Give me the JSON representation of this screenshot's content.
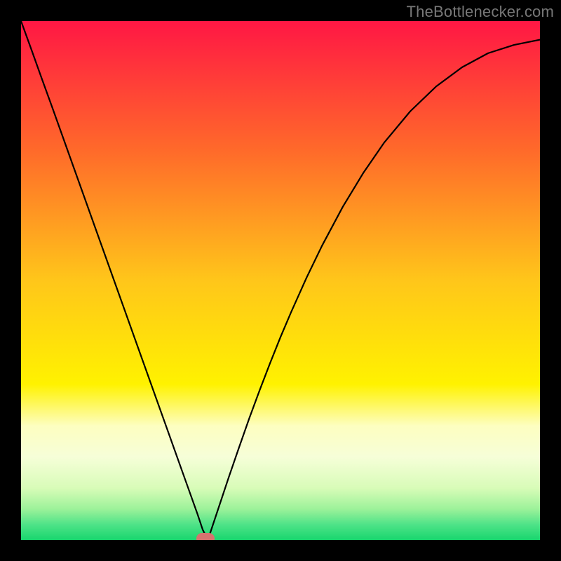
{
  "attribution": "TheBottlenecker.com",
  "chart_data": {
    "type": "line",
    "title": "",
    "xlabel": "",
    "ylabel": "",
    "xlim": [
      0,
      1
    ],
    "ylim": [
      0,
      1
    ],
    "x": [
      0.0,
      0.02,
      0.04,
      0.06,
      0.08,
      0.1,
      0.12,
      0.14,
      0.16,
      0.18,
      0.2,
      0.22,
      0.24,
      0.26,
      0.28,
      0.3,
      0.32,
      0.34,
      0.35,
      0.36,
      0.38,
      0.4,
      0.42,
      0.44,
      0.46,
      0.48,
      0.5,
      0.52,
      0.55,
      0.58,
      0.62,
      0.66,
      0.7,
      0.75,
      0.8,
      0.85,
      0.9,
      0.95,
      1.0
    ],
    "values": [
      1.0,
      0.945,
      0.889,
      0.834,
      0.778,
      0.722,
      0.666,
      0.61,
      0.554,
      0.498,
      0.442,
      0.386,
      0.33,
      0.274,
      0.218,
      0.162,
      0.106,
      0.05,
      0.02,
      0.0,
      0.06,
      0.12,
      0.178,
      0.235,
      0.289,
      0.341,
      0.391,
      0.438,
      0.505,
      0.567,
      0.642,
      0.708,
      0.766,
      0.826,
      0.874,
      0.911,
      0.938,
      0.954,
      0.964
    ],
    "minimum_marker": {
      "x": 0.355,
      "y": 0.0,
      "color": "#d6736f"
    },
    "background_gradient_stops": [
      {
        "pos": 0.0,
        "color": "#ff1744"
      },
      {
        "pos": 0.25,
        "color": "#ff6a2a"
      },
      {
        "pos": 0.5,
        "color": "#ffc61a"
      },
      {
        "pos": 0.7,
        "color": "#fff200"
      },
      {
        "pos": 0.78,
        "color": "#fdfec0"
      },
      {
        "pos": 0.84,
        "color": "#f6fed8"
      },
      {
        "pos": 0.9,
        "color": "#d8fcb8"
      },
      {
        "pos": 0.94,
        "color": "#9df29a"
      },
      {
        "pos": 0.97,
        "color": "#4fe388"
      },
      {
        "pos": 1.0,
        "color": "#18d66e"
      }
    ]
  },
  "colors": {
    "frame": "#000000",
    "curve": "#000000",
    "marker": "#d6736f",
    "attribution_text": "#777777"
  }
}
